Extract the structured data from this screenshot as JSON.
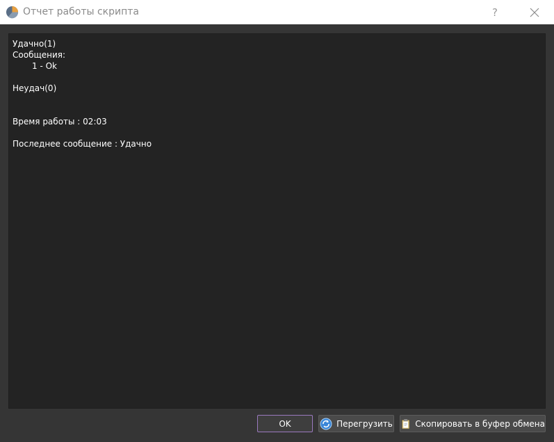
{
  "window": {
    "title": "Отчет работы скрипта",
    "help_label": "?",
    "icons": {
      "app": "pie-chart-icon",
      "close": "close-icon",
      "reload": "refresh-globe-icon",
      "copy": "clipboard-icon"
    }
  },
  "report": {
    "success_line": "Удачно(1)",
    "messages_label": "Сообщения:",
    "message_item": "1 - Ok",
    "failures_line": "Неудач(0)",
    "runtime_line": "Время работы : 02:03",
    "last_message_line": "Последнее сообщение : Удачно"
  },
  "buttons": {
    "ok": "OK",
    "reload": "Перегрузить",
    "copy": "Скопировать в буфер обмена"
  },
  "colors": {
    "background": "#353535",
    "output_background": "#232323",
    "accent_border": "#9b7ac0"
  }
}
